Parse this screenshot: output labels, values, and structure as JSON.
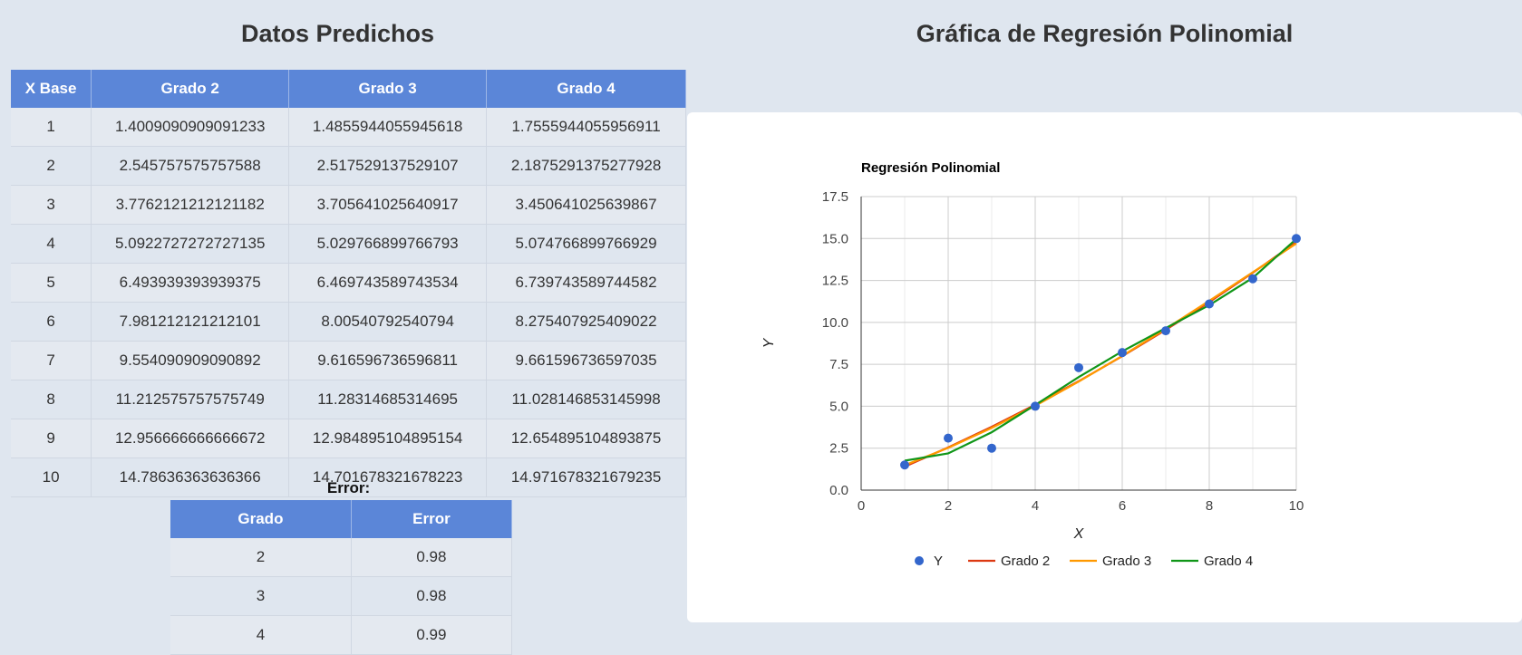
{
  "left": {
    "title": "Datos Predichos",
    "table": {
      "headers": [
        "X Base",
        "Grado 2",
        "Grado 3",
        "Grado 4"
      ],
      "rows": [
        [
          "1",
          "1.4009090909091233",
          "1.4855944055945618",
          "1.7555944055956911"
        ],
        [
          "2",
          "2.545757575757588",
          "2.517529137529107",
          "2.1875291375277928"
        ],
        [
          "3",
          "3.7762121212121182",
          "3.70564102564091​7",
          "3.450641025639867"
        ],
        [
          "4",
          "5.0922727272727135",
          "5.029766899766793",
          "5.074766899766929"
        ],
        [
          "5",
          "6.493939393939375",
          "6.469743589743534",
          "6.739743589744582"
        ],
        [
          "6",
          "7.981212121212101",
          "8.00540792540794",
          "8.275407925409022"
        ],
        [
          "7",
          "9.554090909090892",
          "9.616596736596811",
          "9.661596736597035"
        ],
        [
          "8",
          "11.212575757575749",
          "11.28314685314695",
          "11.028146853145998"
        ],
        [
          "9",
          "12.956666666666672",
          "12.984895104895154",
          "12.654895104893875"
        ],
        [
          "10",
          "14.78636363636366",
          "14.701678321678223",
          "14.971678321679235"
        ]
      ]
    },
    "error_label": "Error:",
    "error_table": {
      "headers": [
        "Grado",
        "Error"
      ],
      "rows": [
        [
          "2",
          "0.98"
        ],
        [
          "3",
          "0.98"
        ],
        [
          "4",
          "0.99"
        ]
      ]
    }
  },
  "right": {
    "title": "Gráfica de Regresión Polinomial"
  },
  "chart_data": {
    "type": "line",
    "title": "Regresión Polinomial",
    "xlabel": "X",
    "ylabel": "Y",
    "xlim": [
      0,
      10
    ],
    "ylim": [
      0,
      17.5
    ],
    "x_ticks": [
      0,
      2,
      4,
      6,
      8,
      10
    ],
    "y_ticks": [
      "0.0",
      "2.5",
      "5.0",
      "7.5",
      "10.0",
      "12.5",
      "15.0",
      "17.5"
    ],
    "grid": true,
    "legend_position": "bottom",
    "points": {
      "name": "Y",
      "color": "#3366cc",
      "x": [
        1,
        2,
        3,
        4,
        5,
        6,
        7,
        8,
        9,
        10
      ],
      "y": [
        1.5,
        3.1,
        2.5,
        5.0,
        7.3,
        8.2,
        9.5,
        11.1,
        12.6,
        15.0
      ]
    },
    "series": [
      {
        "name": "Grado 2",
        "color": "#dc3912",
        "x": [
          1,
          2,
          3,
          4,
          5,
          6,
          7,
          8,
          9,
          10
        ],
        "values": [
          1.4009,
          2.5458,
          3.7762,
          5.0923,
          6.4939,
          7.9812,
          9.5541,
          11.2126,
          12.9567,
          14.7864
        ]
      },
      {
        "name": "Grado 3",
        "color": "#ff9900",
        "x": [
          1,
          2,
          3,
          4,
          5,
          6,
          7,
          8,
          9,
          10
        ],
        "values": [
          1.4856,
          2.5175,
          3.7056,
          5.0298,
          6.4697,
          8.0054,
          9.6166,
          11.2831,
          12.9849,
          14.7017
        ]
      },
      {
        "name": "Grado 4",
        "color": "#109618",
        "x": [
          1,
          2,
          3,
          4,
          5,
          6,
          7,
          8,
          9,
          10
        ],
        "values": [
          1.7556,
          2.1875,
          3.4506,
          5.0748,
          6.7397,
          8.2754,
          9.6616,
          11.0281,
          12.6549,
          14.9717
        ]
      }
    ]
  }
}
